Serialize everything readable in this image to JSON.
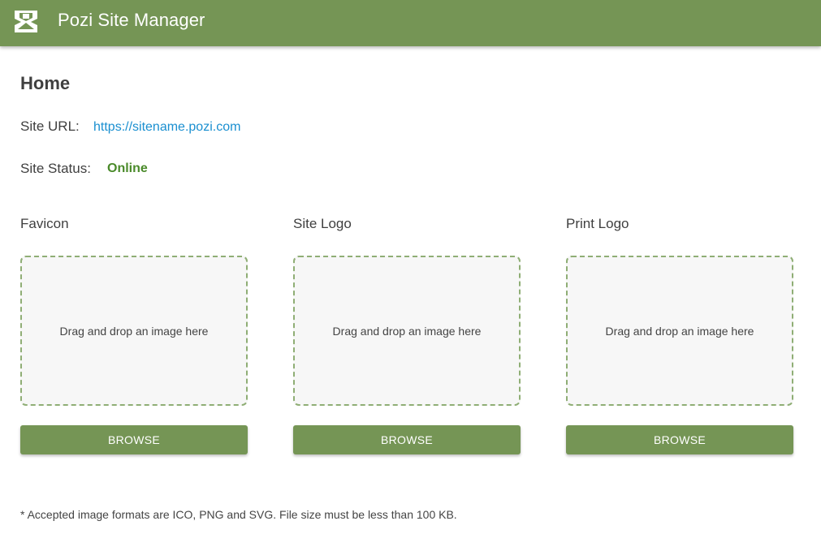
{
  "header": {
    "title": "Pozi Site Manager",
    "logo_icon": "pozi-logo-icon",
    "bar_color": "#759555"
  },
  "page": {
    "title": "Home",
    "site_url_label": "Site URL:",
    "site_url_value": "https://sitename.pozi.com",
    "site_status_label": "Site Status:",
    "site_status_value": "Online",
    "status_color": "#4a8a2a",
    "link_color": "#1a8fd0"
  },
  "uploads": [
    {
      "title": "Favicon",
      "dropzone_text": "Drag and drop an image here",
      "button_label": "BROWSE"
    },
    {
      "title": "Site Logo",
      "dropzone_text": "Drag and drop an image here",
      "button_label": "BROWSE"
    },
    {
      "title": "Print Logo",
      "dropzone_text": "Drag and drop an image here",
      "button_label": "BROWSE"
    }
  ],
  "footnote": "* Accepted image formats are ICO, PNG and SVG. File size must be less than 100 KB."
}
